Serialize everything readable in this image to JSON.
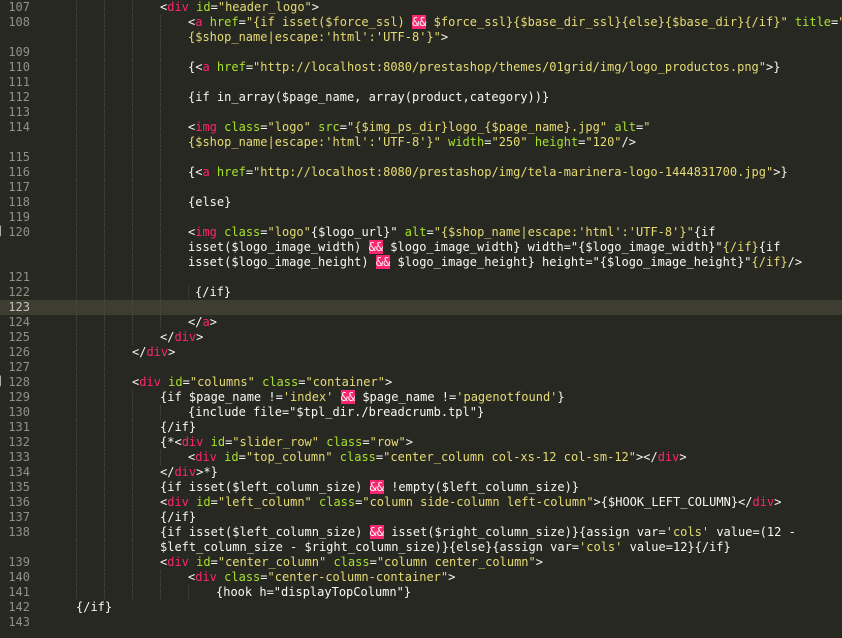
{
  "lines": [
    {
      "n": "107",
      "indent": 160,
      "guides": [
        76,
        104,
        132
      ],
      "segs": [
        [
          "p",
          "<"
        ],
        [
          "t",
          "div"
        ],
        [
          "a",
          " id"
        ],
        [
          "p",
          "="
        ],
        [
          "s",
          "\"header_logo\""
        ],
        [
          "p",
          ">"
        ]
      ]
    },
    {
      "n": "108",
      "indent": 188,
      "guides": [
        76,
        104,
        132,
        160
      ],
      "segs": [
        [
          "p",
          "<"
        ],
        [
          "t",
          "a"
        ],
        [
          "a",
          " href"
        ],
        [
          "p",
          "="
        ],
        [
          "s",
          "\"{if isset($force_ssl) "
        ],
        [
          "hl",
          "&&"
        ],
        [
          "s",
          " $force_ssl}{$base_dir_ssl}{else}{$base_dir}{/if}\""
        ],
        [
          "a",
          " title"
        ],
        [
          "p",
          "="
        ],
        [
          "s",
          "\""
        ]
      ]
    },
    {
      "n": "",
      "indent": 188,
      "guides": [
        76,
        104,
        132,
        160
      ],
      "segs": [
        [
          "s",
          "{$shop_name|escape:'html':'UTF-8'}\""
        ],
        [
          "p",
          ">"
        ]
      ]
    },
    {
      "n": "109",
      "indent": 0,
      "guides": [
        76,
        104,
        132,
        160
      ],
      "segs": []
    },
    {
      "n": "110",
      "indent": 188,
      "guides": [
        76,
        104,
        132,
        160
      ],
      "segs": [
        [
          "p",
          "{<"
        ],
        [
          "t",
          "a"
        ],
        [
          "a",
          " href"
        ],
        [
          "p",
          "="
        ],
        [
          "s",
          "\"http://localhost:8080/prestashop/themes/01grid/img/logo_productos.png\""
        ],
        [
          "p",
          ">}"
        ]
      ]
    },
    {
      "n": "111",
      "indent": 0,
      "guides": [
        76,
        104,
        132,
        160
      ],
      "segs": []
    },
    {
      "n": "112",
      "indent": 188,
      "guides": [
        76,
        104,
        132,
        160
      ],
      "segs": [
        [
          "p",
          "{if in_array($page_name, array(product,category))}"
        ]
      ]
    },
    {
      "n": "113",
      "indent": 0,
      "guides": [
        76,
        104,
        132,
        160
      ],
      "segs": []
    },
    {
      "n": "114",
      "indent": 188,
      "guides": [
        76,
        104,
        132,
        160
      ],
      "segs": [
        [
          "p",
          "<"
        ],
        [
          "t",
          "img"
        ],
        [
          "a",
          " class"
        ],
        [
          "p",
          "="
        ],
        [
          "s",
          "\"logo\""
        ],
        [
          "a",
          " src"
        ],
        [
          "p",
          "="
        ],
        [
          "s",
          "\"{$img_ps_dir}logo_{$page_name}.jpg\""
        ],
        [
          "a",
          " alt"
        ],
        [
          "p",
          "="
        ],
        [
          "s",
          "\""
        ]
      ]
    },
    {
      "n": "",
      "indent": 188,
      "guides": [
        76,
        104,
        132,
        160
      ],
      "segs": [
        [
          "s",
          "{$shop_name|escape:'html':'UTF-8'}\""
        ],
        [
          "a",
          " width"
        ],
        [
          "p",
          "="
        ],
        [
          "s",
          "\"250\""
        ],
        [
          "a",
          " height"
        ],
        [
          "p",
          "="
        ],
        [
          "s",
          "\"120\""
        ],
        [
          "p",
          "/>"
        ]
      ]
    },
    {
      "n": "115",
      "indent": 0,
      "guides": [
        76,
        104,
        132,
        160
      ],
      "segs": []
    },
    {
      "n": "116",
      "indent": 188,
      "guides": [
        76,
        104,
        132,
        160
      ],
      "segs": [
        [
          "p",
          "{<"
        ],
        [
          "t",
          "a"
        ],
        [
          "a",
          " href"
        ],
        [
          "p",
          "="
        ],
        [
          "s",
          "\"http://localhost:8080/prestashop/img/tela-marinera-logo-1444831700.jpg\""
        ],
        [
          "p",
          ">}"
        ]
      ]
    },
    {
      "n": "117",
      "indent": 0,
      "guides": [
        76,
        104,
        132,
        160
      ],
      "segs": []
    },
    {
      "n": "118",
      "indent": 188,
      "guides": [
        76,
        104,
        132,
        160
      ],
      "segs": [
        [
          "p",
          "{else}"
        ]
      ]
    },
    {
      "n": "119",
      "indent": 0,
      "guides": [
        76,
        104,
        132,
        160
      ],
      "segs": []
    },
    {
      "n": "120",
      "indent": 188,
      "guides": [
        76,
        104,
        132,
        160
      ],
      "mark": true,
      "segs": [
        [
          "p",
          "<"
        ],
        [
          "t",
          "img"
        ],
        [
          "a",
          " class"
        ],
        [
          "p",
          "="
        ],
        [
          "s",
          "\"logo\""
        ],
        [
          "p",
          "{$logo_url}\""
        ],
        [
          "a",
          " alt"
        ],
        [
          "p",
          "="
        ],
        [
          "s",
          "\"{$shop_name|escape:'html':'UTF-8'}\""
        ],
        [
          "p",
          "{if"
        ]
      ]
    },
    {
      "n": "",
      "indent": 188,
      "guides": [
        76,
        104,
        132,
        160
      ],
      "segs": [
        [
          "p",
          "isset($logo_image_width) "
        ],
        [
          "hl",
          "&&"
        ],
        [
          "p",
          " $logo_image_width} width=\"{$logo_image_width}\""
        ],
        [
          "s",
          "{/if}"
        ],
        [
          "p",
          "{if"
        ]
      ]
    },
    {
      "n": "",
      "indent": 188,
      "guides": [
        76,
        104,
        132,
        160
      ],
      "segs": [
        [
          "p",
          "isset($logo_image_height) "
        ],
        [
          "hl",
          "&&"
        ],
        [
          "p",
          " $logo_image_height} height=\"{$logo_image_height}\""
        ],
        [
          "s",
          "{/if}"
        ],
        [
          "p",
          "/>"
        ]
      ]
    },
    {
      "n": "121",
      "indent": 0,
      "guides": [
        76,
        104,
        132,
        160
      ],
      "segs": []
    },
    {
      "n": "122",
      "indent": 195,
      "guides": [
        76,
        104,
        132,
        160,
        188
      ],
      "segs": [
        [
          "p",
          "{/if}"
        ]
      ]
    },
    {
      "n": "123",
      "indent": 0,
      "guides": [
        76,
        104,
        132,
        160
      ],
      "active": true,
      "segs": []
    },
    {
      "n": "124",
      "indent": 188,
      "guides": [
        76,
        104,
        132,
        160
      ],
      "segs": [
        [
          "p",
          "</"
        ],
        [
          "t",
          "a"
        ],
        [
          "p",
          ">"
        ]
      ]
    },
    {
      "n": "125",
      "indent": 160,
      "guides": [
        76,
        104,
        132
      ],
      "segs": [
        [
          "p",
          "</"
        ],
        [
          "t",
          "div"
        ],
        [
          "p",
          ">"
        ]
      ]
    },
    {
      "n": "126",
      "indent": 132,
      "guides": [
        76,
        104
      ],
      "segs": [
        [
          "p",
          "</"
        ],
        [
          "t",
          "div"
        ],
        [
          "p",
          ">"
        ]
      ]
    },
    {
      "n": "127",
      "indent": 0,
      "guides": [
        76,
        104
      ],
      "segs": []
    },
    {
      "n": "128",
      "indent": 132,
      "guides": [
        76,
        104
      ],
      "mark": true,
      "segs": [
        [
          "p",
          "<"
        ],
        [
          "t",
          "div"
        ],
        [
          "a",
          " id"
        ],
        [
          "p",
          "="
        ],
        [
          "s",
          "\"columns\""
        ],
        [
          "a",
          " class"
        ],
        [
          "p",
          "="
        ],
        [
          "s",
          "\"container\""
        ],
        [
          "p",
          ">"
        ]
      ]
    },
    {
      "n": "129",
      "indent": 160,
      "guides": [
        76,
        104,
        132
      ],
      "segs": [
        [
          "p",
          "{if $page_name !="
        ],
        [
          "s",
          "'index'"
        ],
        [
          "p",
          " "
        ],
        [
          "hl",
          "&&"
        ],
        [
          "p",
          " $page_name !="
        ],
        [
          "s",
          "'pagenotfound'"
        ],
        [
          "p",
          "}"
        ]
      ]
    },
    {
      "n": "130",
      "indent": 188,
      "guides": [
        76,
        104,
        132,
        160
      ],
      "segs": [
        [
          "p",
          "{include file=\"$tpl_dir./breadcrumb.tpl\"}"
        ]
      ]
    },
    {
      "n": "131",
      "indent": 160,
      "guides": [
        76,
        104,
        132
      ],
      "segs": [
        [
          "p",
          "{/if}"
        ]
      ]
    },
    {
      "n": "132",
      "indent": 160,
      "guides": [
        76,
        104,
        132
      ],
      "segs": [
        [
          "p",
          "{*<"
        ],
        [
          "t",
          "div"
        ],
        [
          "a",
          " id"
        ],
        [
          "p",
          "="
        ],
        [
          "s",
          "\"slider_row\""
        ],
        [
          "a",
          " class"
        ],
        [
          "p",
          "="
        ],
        [
          "s",
          "\"row\""
        ],
        [
          "p",
          ">"
        ]
      ]
    },
    {
      "n": "133",
      "indent": 188,
      "guides": [
        76,
        104,
        132,
        160
      ],
      "segs": [
        [
          "p",
          "<"
        ],
        [
          "t",
          "div"
        ],
        [
          "a",
          " id"
        ],
        [
          "p",
          "="
        ],
        [
          "s",
          "\"top_column\""
        ],
        [
          "a",
          " class"
        ],
        [
          "p",
          "="
        ],
        [
          "s",
          "\"center_column col-xs-12 col-sm-12\""
        ],
        [
          "p",
          "></"
        ],
        [
          "t",
          "div"
        ],
        [
          "p",
          ">"
        ]
      ]
    },
    {
      "n": "134",
      "indent": 160,
      "guides": [
        76,
        104,
        132
      ],
      "segs": [
        [
          "p",
          "</"
        ],
        [
          "t",
          "div"
        ],
        [
          "p",
          ">*}"
        ]
      ]
    },
    {
      "n": "135",
      "indent": 160,
      "guides": [
        76,
        104,
        132
      ],
      "segs": [
        [
          "p",
          "{if isset($left_column_size) "
        ],
        [
          "hl",
          "&&"
        ],
        [
          "p",
          " !empty($left_column_size)}"
        ]
      ]
    },
    {
      "n": "136",
      "indent": 160,
      "guides": [
        76,
        104,
        132
      ],
      "segs": [
        [
          "p",
          "<"
        ],
        [
          "t",
          "div"
        ],
        [
          "a",
          " id"
        ],
        [
          "p",
          "="
        ],
        [
          "s",
          "\"left_column\""
        ],
        [
          "a",
          " class"
        ],
        [
          "p",
          "="
        ],
        [
          "s",
          "\"column side-column left-column\""
        ],
        [
          "p",
          ">{$HOOK_LEFT_COLUMN}</"
        ],
        [
          "t",
          "div"
        ],
        [
          "p",
          ">"
        ]
      ]
    },
    {
      "n": "137",
      "indent": 160,
      "guides": [
        76,
        104,
        132
      ],
      "segs": [
        [
          "p",
          "{/if}"
        ]
      ]
    },
    {
      "n": "138",
      "indent": 160,
      "guides": [
        76,
        104,
        132
      ],
      "segs": [
        [
          "p",
          "{if isset($left_column_size) "
        ],
        [
          "hl",
          "&&"
        ],
        [
          "p",
          " isset($right_column_size)}{assign var="
        ],
        [
          "s",
          "'cols'"
        ],
        [
          "p",
          " value=(12 -"
        ]
      ]
    },
    {
      "n": "",
      "indent": 160,
      "guides": [
        76,
        104,
        132
      ],
      "segs": [
        [
          "p",
          "$left_column_size - $right_column_size)}{else}{assign var="
        ],
        [
          "s",
          "'cols'"
        ],
        [
          "p",
          " value=12}{/if}"
        ]
      ]
    },
    {
      "n": "139",
      "indent": 160,
      "guides": [
        76,
        104,
        132
      ],
      "segs": [
        [
          "p",
          "<"
        ],
        [
          "t",
          "div"
        ],
        [
          "a",
          " id"
        ],
        [
          "p",
          "="
        ],
        [
          "s",
          "\"center_column\""
        ],
        [
          "a",
          " class"
        ],
        [
          "p",
          "="
        ],
        [
          "s",
          "\"column center_column\""
        ],
        [
          "p",
          ">"
        ]
      ]
    },
    {
      "n": "140",
      "indent": 188,
      "guides": [
        76,
        104,
        132,
        160
      ],
      "segs": [
        [
          "p",
          "<"
        ],
        [
          "t",
          "div"
        ],
        [
          "a",
          " class"
        ],
        [
          "p",
          "="
        ],
        [
          "s",
          "\"center-column-container\""
        ],
        [
          "p",
          ">"
        ]
      ]
    },
    {
      "n": "141",
      "indent": 216,
      "guides": [
        76,
        104,
        132,
        160,
        188
      ],
      "segs": [
        [
          "p",
          "{hook h=\"displayTopColumn\"}"
        ]
      ]
    },
    {
      "n": "142",
      "indent": 76,
      "guides": [],
      "segs": [
        [
          "p",
          "{/if}"
        ]
      ]
    },
    {
      "n": "143",
      "indent": 0,
      "guides": [],
      "segs": []
    }
  ]
}
